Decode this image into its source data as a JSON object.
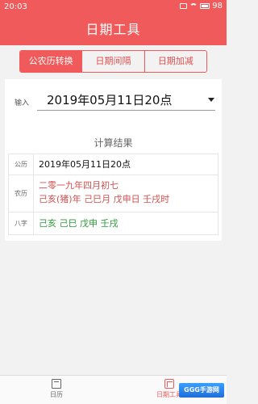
{
  "status": {
    "time": "20:03",
    "battery": "98"
  },
  "header": {
    "title": "日期工具"
  },
  "tabs": [
    {
      "label": "公农历转换",
      "active": true
    },
    {
      "label": "日期间隔",
      "active": false
    },
    {
      "label": "日期加减",
      "active": false
    }
  ],
  "input": {
    "label": "输入",
    "value": "2019年05月11日20点"
  },
  "result": {
    "title": "计算结果",
    "rows": [
      {
        "label": "公历",
        "lines": [
          "2019年05月11日20点"
        ]
      },
      {
        "label": "农历",
        "lines": [
          "二零一九年四月初七",
          "己亥(猪)年 己巳月 戊申日 壬戌时"
        ]
      },
      {
        "label": "八字",
        "lines": [
          "己亥 己巳 戊申 壬戌"
        ]
      }
    ]
  },
  "bottom_nav": [
    {
      "label": "日历",
      "icon": "calendar-icon"
    },
    {
      "label": "日期工具",
      "icon": "tools-icon"
    }
  ],
  "watermark": {
    "text": "GGG手游网"
  },
  "colors": {
    "primary": "#f05a5a",
    "lunar_text": "#d25050",
    "bazi_text": "#2e9a3a"
  }
}
